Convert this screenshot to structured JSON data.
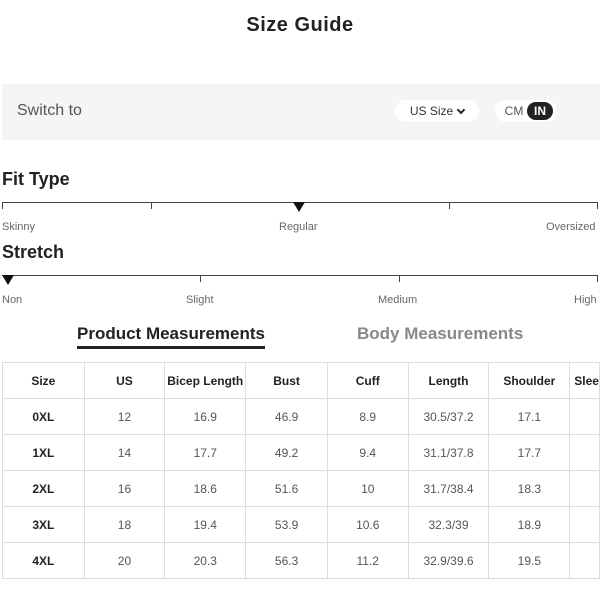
{
  "page": {
    "title": "Size Guide"
  },
  "switch_bar": {
    "label": "Switch to",
    "size_select": {
      "value": "US Size"
    },
    "unit_toggle": {
      "cm_label": "CM",
      "in_label": "IN",
      "selected": "IN"
    }
  },
  "fit_type": {
    "title": "Fit Type",
    "labels": [
      "Skinny",
      "Regular",
      "Oversized"
    ],
    "selected": "Regular"
  },
  "stretch": {
    "title": "Stretch",
    "labels": [
      "Non",
      "Slight",
      "Medium",
      "High"
    ],
    "selected": "Non"
  },
  "tabs": [
    {
      "label": "Product Measurements",
      "active": true
    },
    {
      "label": "Body Measurements",
      "active": false
    }
  ],
  "table": {
    "headers": [
      "Size",
      "US",
      "Bicep Length",
      "Bust",
      "Cuff",
      "Length",
      "Shoulder",
      "Slee"
    ],
    "rows": [
      [
        "0XL",
        "12",
        "16.9",
        "46.9",
        "8.9",
        "30.5/37.2",
        "17.1",
        ""
      ],
      [
        "1XL",
        "14",
        "17.7",
        "49.2",
        "9.4",
        "31.1/37.8",
        "17.7",
        ""
      ],
      [
        "2XL",
        "16",
        "18.6",
        "51.6",
        "10",
        "31.7/38.4",
        "18.3",
        ""
      ],
      [
        "3XL",
        "18",
        "19.4",
        "53.9",
        "10.6",
        "32.3/39",
        "18.9",
        ""
      ],
      [
        "4XL",
        "20",
        "20.3",
        "56.3",
        "11.2",
        "32.9/39.6",
        "19.5",
        ""
      ]
    ]
  }
}
